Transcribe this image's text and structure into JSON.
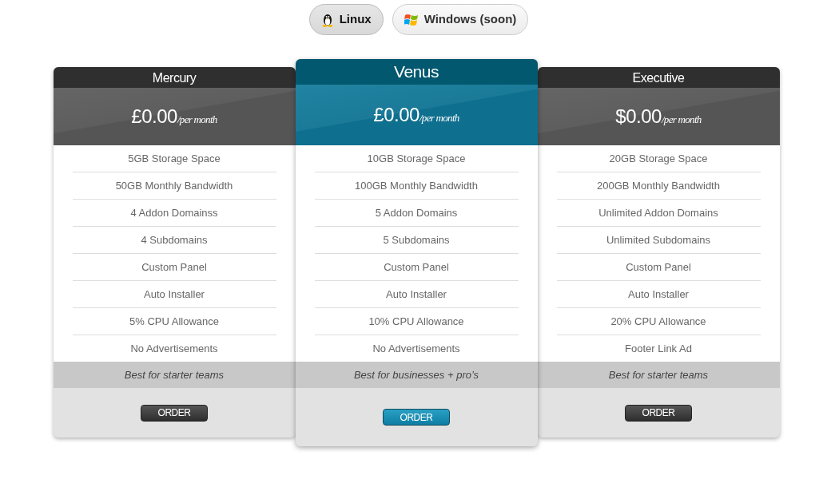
{
  "os_tabs": [
    {
      "label": "Linux",
      "kind": "linux",
      "selected": true
    },
    {
      "label": "Windows (soon)",
      "kind": "windows",
      "selected": false
    }
  ],
  "plans": [
    {
      "name": "Mercury",
      "featured": false,
      "price": "£0.00",
      "period": "/per month",
      "features": [
        "5GB Storage Space",
        "50GB Monthly Bandwidth",
        "4 Addon Domainss",
        "4 Subdomains",
        "Custom Panel",
        "Auto Installer",
        "5% CPU Allowance",
        "No Advertisements"
      ],
      "tagline": "Best for starter teams",
      "button": "ORDER"
    },
    {
      "name": "Venus",
      "featured": true,
      "price": "£0.00",
      "period": "/per month",
      "features": [
        "10GB Storage Space",
        "100GB Monthly Bandwidth",
        "5 Addon Domains",
        "5 Subdomains",
        "Custom Panel",
        "Auto Installer",
        "10% CPU Allowance",
        "No Advertisements"
      ],
      "tagline": "Best for businesses + pro’s",
      "button": "ORDER"
    },
    {
      "name": "Executive",
      "featured": false,
      "price": "$0.00",
      "period": "/per month",
      "features": [
        "20GB Storage Space",
        "200GB Monthly Bandwidth",
        "Unlimited Addon Domains",
        "Unlimited Subdomains",
        "Custom Panel",
        "Auto Installer",
        "20% CPU Allowance",
        "Footer Link Ad"
      ],
      "tagline": "Best for starter teams",
      "button": "ORDER"
    }
  ]
}
